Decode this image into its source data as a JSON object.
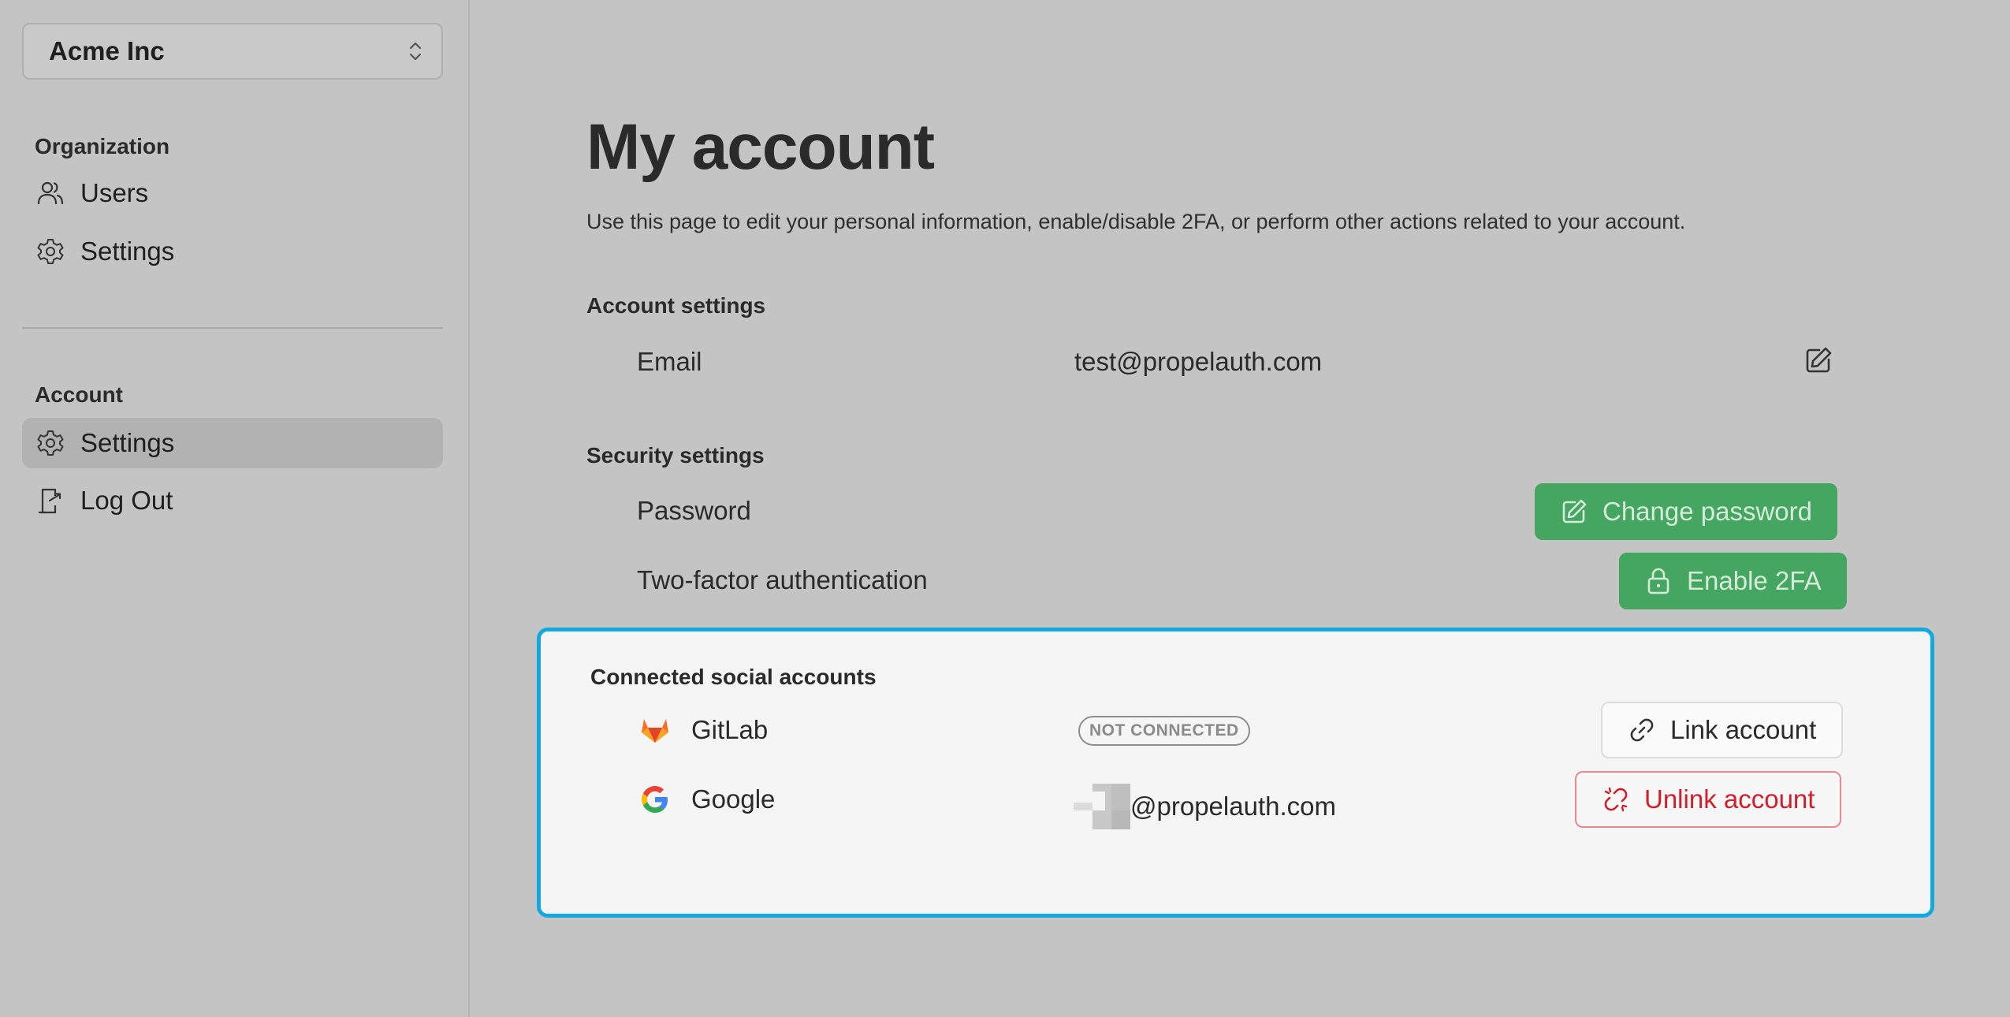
{
  "sidebar": {
    "org_name": "Acme Inc",
    "org_section": "Organization",
    "org_items": [
      {
        "label": "Users",
        "icon": "users-icon"
      },
      {
        "label": "Settings",
        "icon": "gear-icon"
      }
    ],
    "account_section": "Account",
    "account_items": [
      {
        "label": "Settings",
        "icon": "gear-icon",
        "active": true
      },
      {
        "label": "Log Out",
        "icon": "logout-icon"
      }
    ]
  },
  "main": {
    "title": "My account",
    "description": "Use this page to edit your personal information, enable/disable 2FA, or perform other actions related to your account.",
    "account_settings": {
      "title": "Account settings",
      "email_label": "Email",
      "email_value": "test@propelauth.com"
    },
    "security_settings": {
      "title": "Security settings",
      "password_label": "Password",
      "change_password_button": "Change password",
      "twofa_label": "Two-factor authentication",
      "enable_2fa_button": "Enable 2FA"
    },
    "social_accounts": {
      "title": "Connected social accounts",
      "providers": [
        {
          "name": "GitLab",
          "status": "NOT CONNECTED",
          "action": "Link account"
        },
        {
          "name": "Google",
          "email_suffix": "@propelauth.com",
          "action": "Unlink account"
        }
      ]
    }
  },
  "colors": {
    "primary_green": "#45a661",
    "danger_red": "#d21d2b",
    "highlight_blue": "#13a9e0",
    "page_bg": "#c4c4c4"
  }
}
